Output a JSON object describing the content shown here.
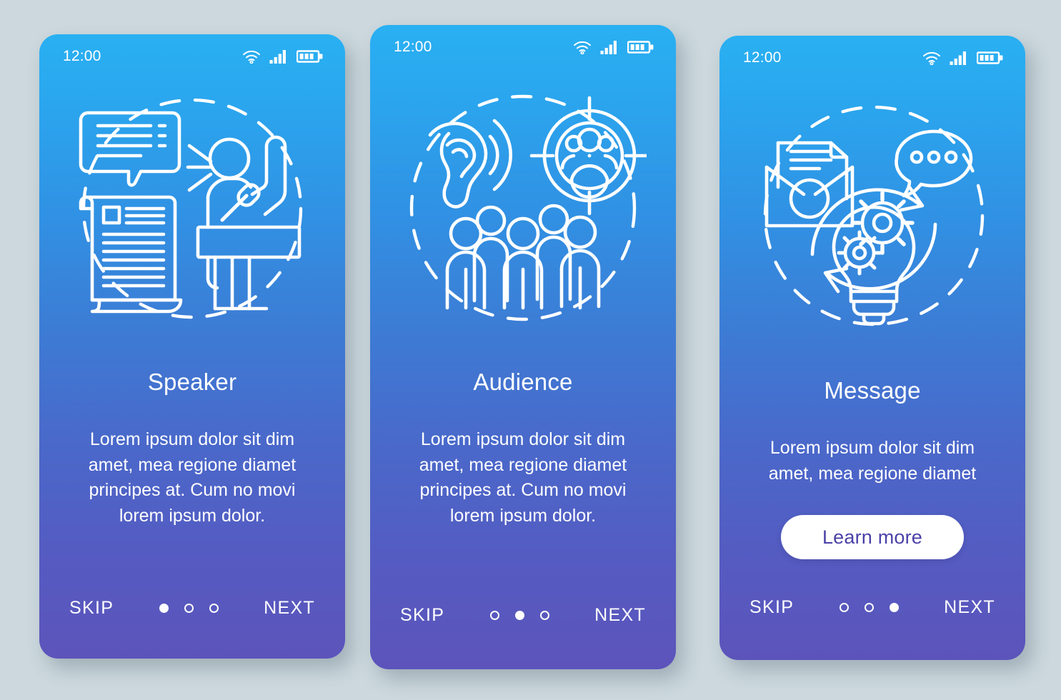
{
  "background_color": "#ccd8dd",
  "theme": {
    "gradient_top": "#29b0f2",
    "gradient_mid": "#3d7bd4",
    "gradient_bottom": "#5c54bb",
    "text_color": "#ffffff",
    "button_bg": "#ffffff",
    "button_text_color": "#4a41a8"
  },
  "status_bar": {
    "time": "12:00",
    "icons": [
      "wifi-icon",
      "cellular-signal-icon",
      "battery-icon"
    ]
  },
  "nav": {
    "skip_label": "SKIP",
    "next_label": "NEXT",
    "dot_count": 3
  },
  "screens": [
    {
      "id": "speaker",
      "title": "Speaker",
      "body": "Lorem ipsum dolor sit dim amet, mea regione diamet principes at. Cum no movi lorem ipsum dolor.",
      "active_dot": 0,
      "has_button": false,
      "button_label": "",
      "illustration_elements": [
        "speech-bubble-icon",
        "scroll-document-icon",
        "speaker-at-podium-icon",
        "dashed-circle-icon"
      ]
    },
    {
      "id": "audience",
      "title": "Audience",
      "body": "Lorem ipsum dolor sit dim amet, mea regione diamet principes at. Cum no movi lorem ipsum dolor.",
      "active_dot": 1,
      "has_button": false,
      "button_label": "",
      "illustration_elements": [
        "ear-listening-icon",
        "target-audience-icon",
        "crowd-people-icon",
        "dashed-circle-icon"
      ]
    },
    {
      "id": "message",
      "title": "Message",
      "body": "Lorem ipsum dolor sit dim amet, mea regione diamet",
      "active_dot": 2,
      "has_button": true,
      "button_label": "Learn more",
      "illustration_elements": [
        "open-envelope-letter-icon",
        "chat-bubble-dots-icon",
        "lightbulb-gears-icon",
        "circular-arrows-icon",
        "dashed-circle-icon"
      ]
    }
  ]
}
